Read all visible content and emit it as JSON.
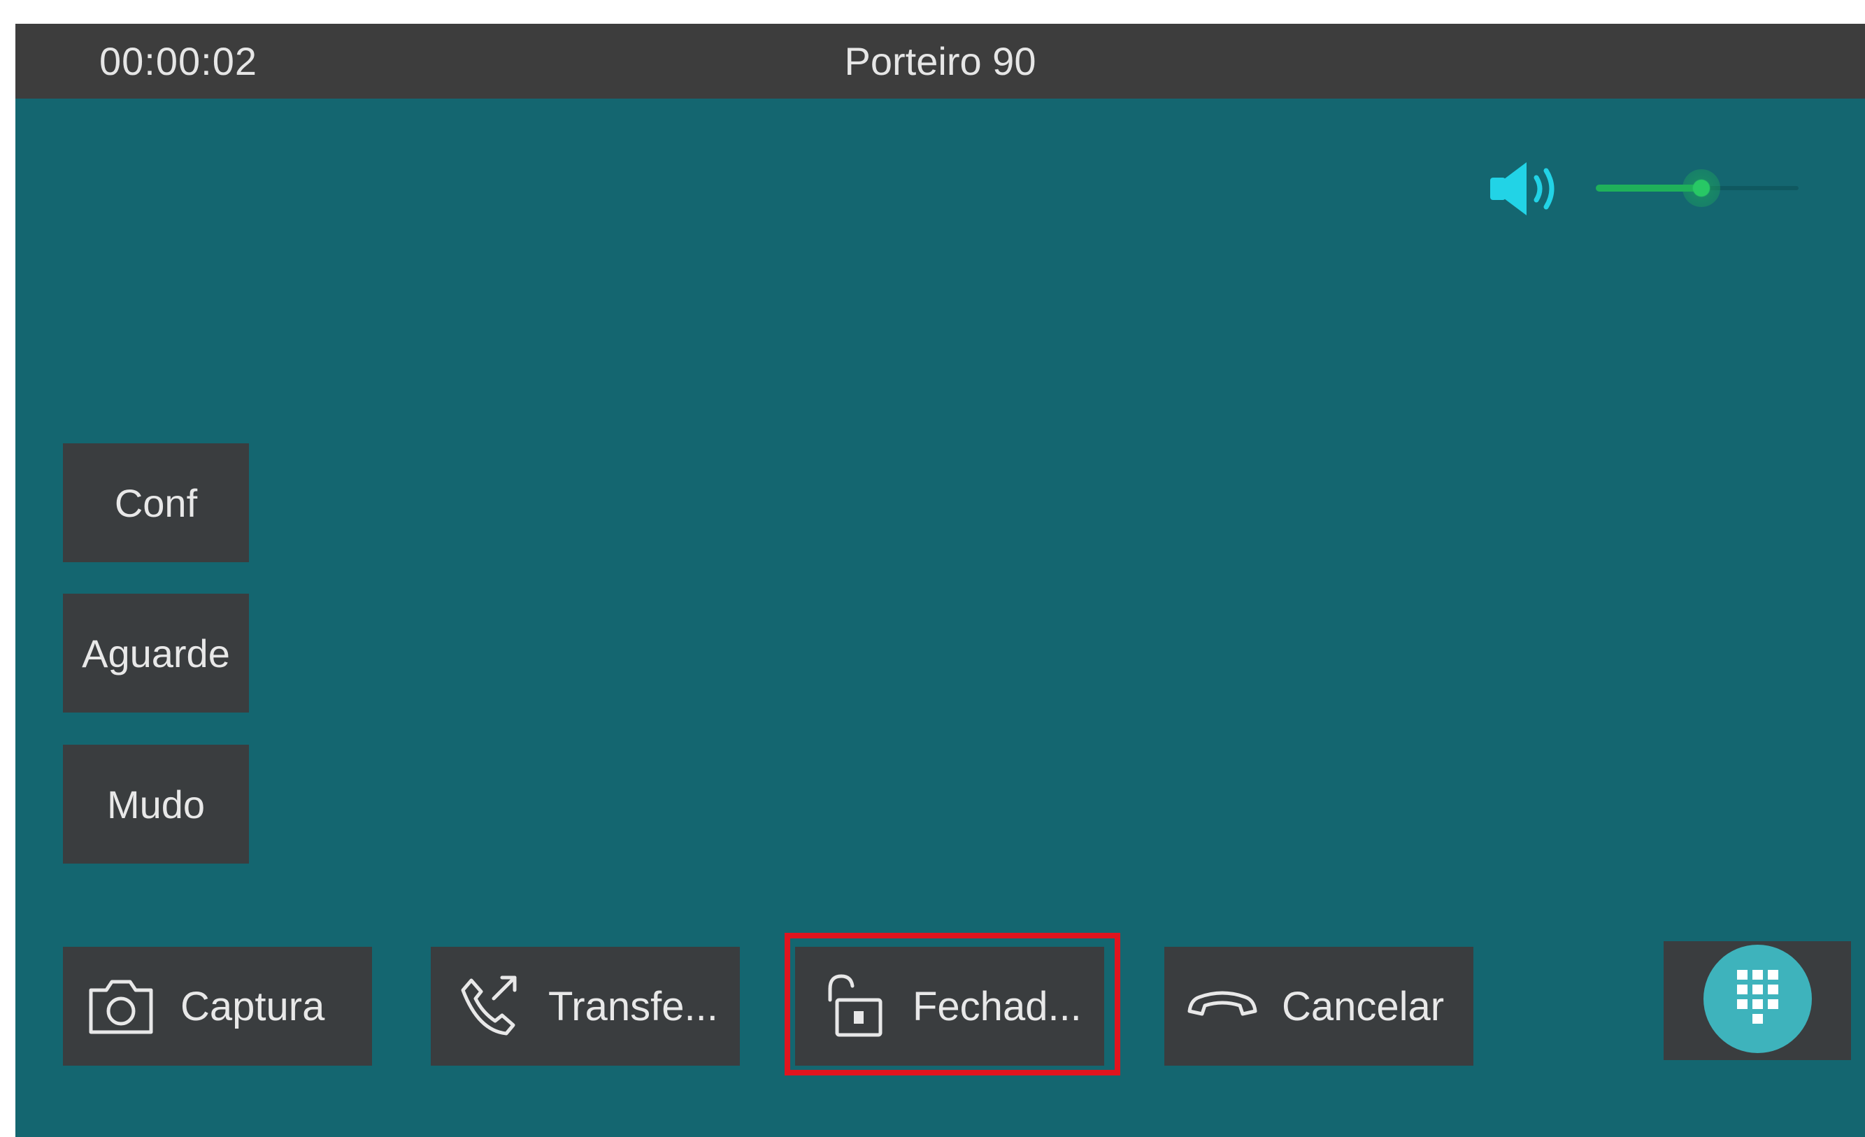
{
  "call": {
    "timer": "00:00:02",
    "caller_name": "Porteiro 90"
  },
  "volume": {
    "icon": "speaker-icon",
    "level": 0.52,
    "fill_color": "#1fb15a",
    "icon_color": "#22d3e6"
  },
  "side_buttons": [
    {
      "label": "Conf"
    },
    {
      "label": "Aguarde"
    },
    {
      "label": "Mudo"
    }
  ],
  "bottom_buttons": [
    {
      "label": "Captura",
      "icon": "camera-icon"
    },
    {
      "label": "Transfe...",
      "icon": "call-transfer-icon"
    },
    {
      "label": "Fechad...",
      "icon": "unlock-icon",
      "highlighted": true
    },
    {
      "label": "Cancelar",
      "icon": "hang-up-icon"
    }
  ],
  "dialpad": {
    "icon": "dialpad-icon",
    "color": "#3eb3bc"
  },
  "colors": {
    "background": "#146670",
    "topbar": "#3d3d3d",
    "button": "#3a3d3f",
    "highlight": "#e0141e"
  }
}
